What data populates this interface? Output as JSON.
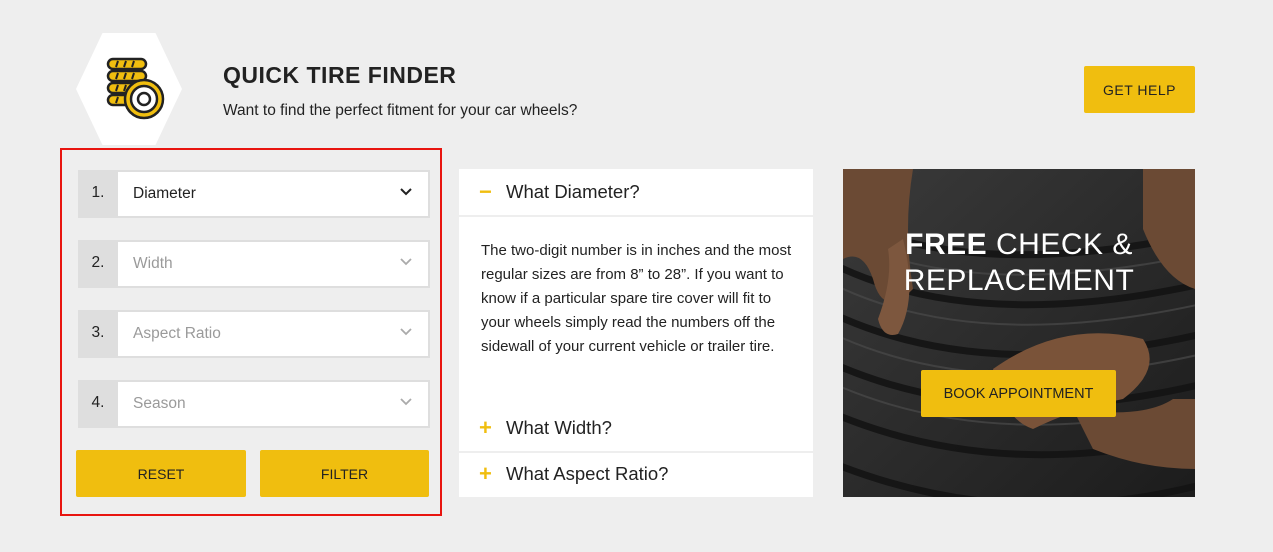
{
  "header": {
    "icon": "tire-stack-icon",
    "title": "QUICK TIRE FINDER",
    "subtitle": "Want to find the perfect fitment for your car wheels?",
    "help_label": "GET HELP"
  },
  "finder": {
    "fields": [
      {
        "number": "1.",
        "value": "Diameter"
      },
      {
        "number": "2.",
        "value": "Width"
      },
      {
        "number": "3.",
        "value": "Aspect Ratio"
      },
      {
        "number": "4.",
        "value": "Season"
      }
    ],
    "reset_label": "RESET",
    "filter_label": "FILTER"
  },
  "faq": {
    "items": [
      {
        "sign": "−",
        "question": "What Diameter?",
        "expanded": true,
        "answer": "The two-digit number is in inches and the most regular sizes are from 8” to 28”. If you want to know if a particular spare tire cover will fit to your wheels simply read the numbers off the sidewall of your current vehicle or trailer tire."
      },
      {
        "sign": "+",
        "question": "What Width?",
        "expanded": false
      },
      {
        "sign": "+",
        "question": "What Aspect Ratio?",
        "expanded": false
      }
    ]
  },
  "promo": {
    "title_bold": "FREE",
    "title_rest": " CHECK &",
    "title_line2": "REPLACEMENT",
    "button_label": "BOOK APPOINTMENT"
  },
  "colors": {
    "accent": "#f0be0f",
    "highlight_border": "#e8140f",
    "background": "#eeeeee"
  }
}
